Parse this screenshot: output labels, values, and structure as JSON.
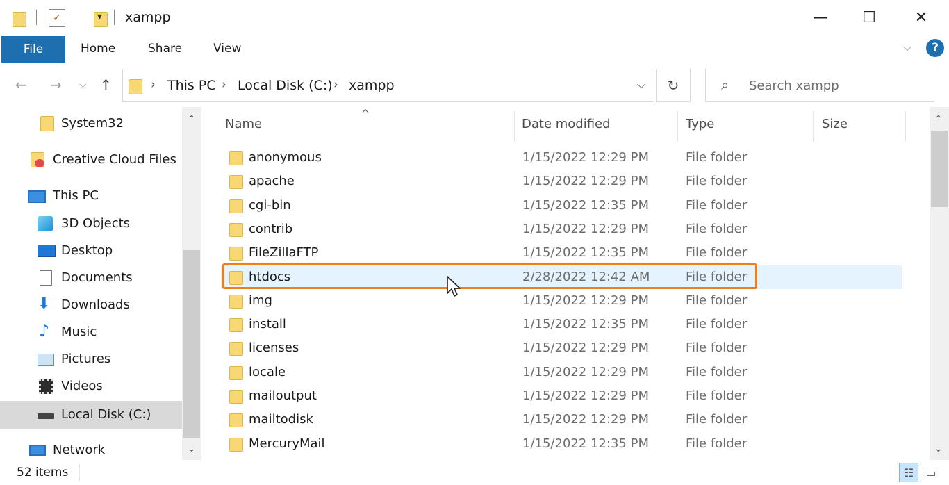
{
  "window": {
    "title": "xampp",
    "controls": {
      "minimize": "—",
      "maximize": "☐",
      "close": "✕"
    }
  },
  "ribbon": {
    "file_tab": "File",
    "tabs": [
      "Home",
      "Share",
      "View"
    ],
    "expand_glyph": "⌵",
    "help_glyph": "?"
  },
  "nav": {
    "back_glyph": "←",
    "forward_glyph": "→",
    "recent_glyph": "⌵",
    "up_glyph": "↑",
    "breadcrumb": [
      "This PC",
      "Local Disk (C:)",
      "xampp"
    ],
    "crumb_sep": "›",
    "dropdown_glyph": "⌵",
    "refresh_glyph": "↻",
    "search_placeholder": "Search xampp",
    "search_glyph": "⌕"
  },
  "navpane": {
    "items": [
      {
        "label": "System32",
        "icon": "folder-icon"
      },
      {
        "label": "Creative Cloud Files",
        "icon": "creative-cloud-icon"
      },
      {
        "label": "This PC",
        "icon": "computer-icon"
      },
      {
        "label": "3D Objects",
        "icon": "cube-icon"
      },
      {
        "label": "Desktop",
        "icon": "desktop-icon"
      },
      {
        "label": "Documents",
        "icon": "document-icon"
      },
      {
        "label": "Downloads",
        "icon": "download-arrow-icon"
      },
      {
        "label": "Music",
        "icon": "music-note-icon"
      },
      {
        "label": "Pictures",
        "icon": "picture-icon"
      },
      {
        "label": "Videos",
        "icon": "film-icon"
      },
      {
        "label": "Local Disk (C:)",
        "icon": "drive-icon",
        "selected": true
      },
      {
        "label": "Network",
        "icon": "network-icon"
      }
    ],
    "scroll_up": "⌃",
    "scroll_down": "⌄"
  },
  "filelist": {
    "columns": {
      "name": "Name",
      "date": "Date modified",
      "type": "Type",
      "size": "Size"
    },
    "sort_glyph": "^",
    "rows": [
      {
        "name": "anonymous",
        "date": "1/15/2022 12:29 PM",
        "type": "File folder"
      },
      {
        "name": "apache",
        "date": "1/15/2022 12:29 PM",
        "type": "File folder"
      },
      {
        "name": "cgi-bin",
        "date": "1/15/2022 12:35 PM",
        "type": "File folder"
      },
      {
        "name": "contrib",
        "date": "1/15/2022 12:29 PM",
        "type": "File folder"
      },
      {
        "name": "FileZillaFTP",
        "date": "1/15/2022 12:35 PM",
        "type": "File folder"
      },
      {
        "name": "htdocs",
        "date": "2/28/2022 12:42 AM",
        "type": "File folder",
        "selected": true
      },
      {
        "name": "img",
        "date": "1/15/2022 12:29 PM",
        "type": "File folder"
      },
      {
        "name": "install",
        "date": "1/15/2022 12:35 PM",
        "type": "File folder"
      },
      {
        "name": "licenses",
        "date": "1/15/2022 12:29 PM",
        "type": "File folder"
      },
      {
        "name": "locale",
        "date": "1/15/2022 12:29 PM",
        "type": "File folder"
      },
      {
        "name": "mailoutput",
        "date": "1/15/2022 12:29 PM",
        "type": "File folder"
      },
      {
        "name": "mailtodisk",
        "date": "1/15/2022 12:29 PM",
        "type": "File folder"
      },
      {
        "name": "MercuryMail",
        "date": "1/15/2022 12:35 PM",
        "type": "File folder"
      }
    ],
    "scroll_up": "⌃",
    "scroll_down": "⌄"
  },
  "status": {
    "item_count": "52 items",
    "details_view_glyph": "☷",
    "thumbnail_view_glyph": "▭"
  },
  "colors": {
    "accent": "#1e6fb0",
    "highlight_outline": "#f07d17",
    "row_selected": "#e5f3ff",
    "folder": "#f8d775"
  }
}
